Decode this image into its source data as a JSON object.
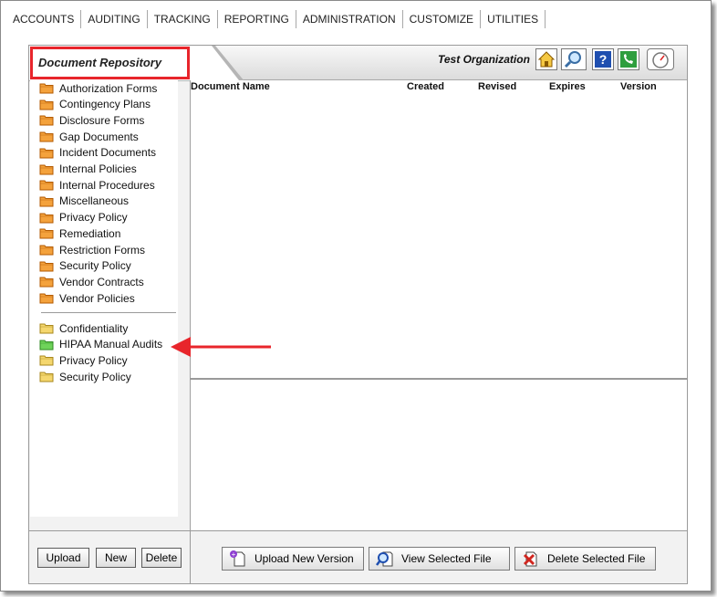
{
  "menu": [
    "ACCOUNTS",
    "AUDITING",
    "TRACKING",
    "REPORTING",
    "ADMINISTRATION",
    "CUSTOMIZE",
    "UTILITIES"
  ],
  "header": {
    "title": "Document Repository",
    "organization": "Test Organization",
    "toolbar_icons": [
      "home-icon",
      "search-icon",
      "help-icon",
      "phone-icon",
      "gauge-icon"
    ]
  },
  "folders": [
    "Authorization Forms",
    "Contingency Plans",
    "Disclosure Forms",
    "Gap Documents",
    "Incident Documents",
    "Internal Policies",
    "Internal Procedures",
    "Miscellaneous",
    "Privacy Policy",
    "Remediation",
    "Restriction Forms",
    "Security Policy",
    "Vendor Contracts",
    "Vendor Policies"
  ],
  "manual_folders": [
    {
      "label": "Confidentiality",
      "color": "#f5d76e"
    },
    {
      "label": "HIPAA Manual Audits",
      "color": "#6fd35a"
    },
    {
      "label": "Privacy Policy",
      "color": "#f5d76e"
    },
    {
      "label": "Security Policy",
      "color": "#f5d76e"
    }
  ],
  "table": {
    "columns": [
      "Document Name",
      "Created",
      "Revised",
      "Expires",
      "Version"
    ],
    "rows": []
  },
  "left_buttons": [
    "Upload",
    "New",
    "Delete"
  ],
  "actions": [
    "Upload New Version",
    "View Selected File",
    "Delete Selected File"
  ],
  "colors": {
    "highlight": "#e8252b",
    "folder_orange": "#f4a23c",
    "folder_yellow": "#f5d76e",
    "folder_green": "#6fd35a"
  }
}
